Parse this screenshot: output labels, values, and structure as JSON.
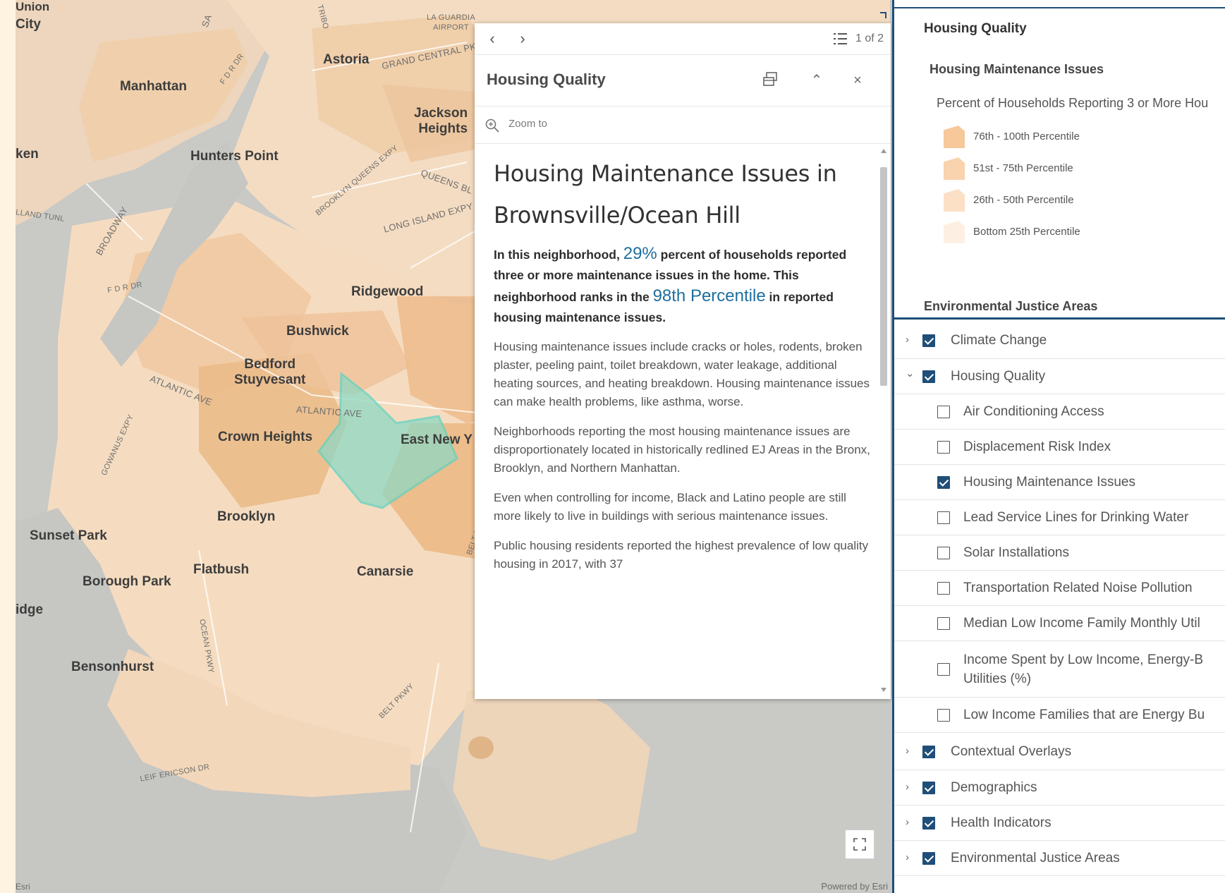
{
  "map": {
    "attribution_left": "Esri",
    "attribution_right": "Powered by Esri",
    "places": {
      "city_top": "City",
      "union": "Union",
      "manhattan": "Manhattan",
      "astoria": "Astoria",
      "jackson_heights": "Jackson\nHeights",
      "hunters_point": "Hunters Point",
      "queens_partial": "ken",
      "ridgewood": "Ridgewood",
      "bushwick": "Bushwick",
      "bedford": "Bedford\nStuyvesant",
      "crown_heights": "Crown Heights",
      "east_new_york": "East New Y",
      "brooklyn": "Brooklyn",
      "sunset_park": "Sunset Park",
      "flatbush": "Flatbush",
      "borough_park": "Borough Park",
      "canarsie": "Canarsie",
      "bensonhurst": "Bensonhurst",
      "ridge_partial": "idge"
    },
    "roads": {
      "la_guardia": "LA GUARDIA\nAIRPORT",
      "grand_central": "GRAND CENTRAL PK",
      "fdr_dr_top": "F D R DR",
      "bqe": "BROOKLYN QUEENS EXPY",
      "queens_blvd": "QUEENS BL",
      "lie": "LONG ISLAND EXPY",
      "broadway": "BROADWAY",
      "land_tunl": "LLAND TUNL",
      "fdr_dr_low": "F D R DR",
      "atlantic_ave_1": "ATLANTIC AVE",
      "atlantic_ave_2": "ATLANTIC AVE",
      "gowanus": "GOWANUS EXPY",
      "ocean_pkwy": "OCEAN PKWY",
      "belt_pkwy_1": "BELT PKWY",
      "belt_pkwy_2": "BELT PKWY",
      "leif_ericson": "LEIF ERICSON DR",
      "sa_partial": "SA",
      "tribo_partial": "TRIBO",
      "ex_partial": "EX"
    }
  },
  "popup": {
    "feature_count": "1 of 2",
    "title": "Housing Quality",
    "zoom_to": "Zoom to",
    "heading": "Housing Maintenance Issues in Brownsville/Ocean Hill",
    "lead_part1": "In this neighborhood, ",
    "lead_pct": "29%",
    "lead_part2": " percent of households reported three or more maintenance issues in the home. This neighborhood ranks in the ",
    "lead_rank": "98th Percentile",
    "lead_part3": " in reported housing maintenance issues.",
    "para1": "Housing maintenance issues include cracks or holes, rodents, broken plaster, peeling paint, toilet breakdown, water leakage, additional heating sources, and heating breakdown. Housing maintenance issues can make health problems, like asthma, worse.",
    "para2": "Neighborhoods reporting the most housing maintenance issues are disproportionately located in historically redlined EJ Areas in the Bronx, Brooklyn, and Northern Manhattan.",
    "para3": "Even when controlling for income, Black and Latino people are still more likely to live in buildings with serious maintenance issues.",
    "para4": "Public housing residents reported the highest prevalence of low quality housing in 2017, with 37"
  },
  "legend": {
    "title": "Housing Quality",
    "subtitle": "Housing Maintenance Issues",
    "field": "Percent of Households Reporting 3 or More Hou",
    "items": [
      {
        "label": "76th - 100th Percentile",
        "color": "#f6c89a"
      },
      {
        "label": "51st - 75th Percentile",
        "color": "#f8d3ad"
      },
      {
        "label": "26th - 50th Percentile",
        "color": "#fbe0c6"
      },
      {
        "label": "Bottom 25th Percentile",
        "color": "#fdf0e2"
      }
    ]
  },
  "layers": {
    "section_title": "Environmental Justice Areas",
    "rows": [
      {
        "label": "Climate Change",
        "checked": true,
        "group": true,
        "expanded": false
      },
      {
        "label": "Housing Quality",
        "checked": true,
        "group": true,
        "expanded": true
      },
      {
        "label": "Air Conditioning Access",
        "checked": false,
        "group": false
      },
      {
        "label": "Displacement Risk Index",
        "checked": false,
        "group": false
      },
      {
        "label": "Housing Maintenance Issues",
        "checked": true,
        "group": false
      },
      {
        "label": "Lead Service Lines for Drinking Water",
        "checked": false,
        "group": false
      },
      {
        "label": "Solar Installations",
        "checked": false,
        "group": false
      },
      {
        "label": "Transportation Related Noise Pollution",
        "checked": false,
        "group": false
      },
      {
        "label": "Median Low Income Family Monthly Util",
        "checked": false,
        "group": false
      },
      {
        "label": "Income Spent by Low Income, Energy-B\nUtilities (%)",
        "checked": false,
        "group": false
      },
      {
        "label": "Low Income Families that are Energy Bu",
        "checked": false,
        "group": false
      },
      {
        "label": "Contextual Overlays",
        "checked": true,
        "group": true,
        "expanded": false
      },
      {
        "label": "Demographics",
        "checked": true,
        "group": true,
        "expanded": false
      },
      {
        "label": "Health Indicators",
        "checked": true,
        "group": true,
        "expanded": false
      },
      {
        "label": "Environmental Justice Areas",
        "checked": true,
        "group": true,
        "expanded": false
      }
    ]
  },
  "colors": {
    "accent": "#1f4e79",
    "highlight_text": "#1e6e9e",
    "selected_area": "#5ed3c2"
  }
}
